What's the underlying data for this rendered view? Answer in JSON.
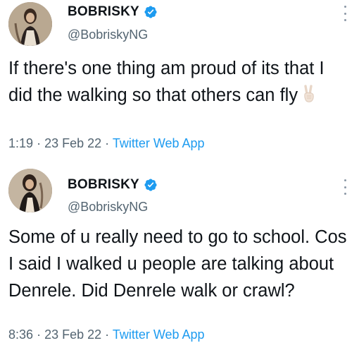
{
  "tweets": [
    {
      "author_name": "BOBRISKY",
      "handle": "@BobriskyNG",
      "text": "If there's one thing am proud of its that I did the walking so that others can fly",
      "emoji": "victory-hand",
      "time": "1:19",
      "date": "23 Feb 22",
      "source": "Twitter Web App",
      "separator": "·"
    },
    {
      "author_name": "BOBRISKY",
      "handle": "@BobriskyNG",
      "text": "Some of u really need to go to school. Cos I said I walked u people are talking about Denrele. Did Denrele walk or crawl?",
      "time": "8:36",
      "date": "23 Feb 22",
      "source": "Twitter Web App",
      "separator": "·"
    }
  ],
  "colors": {
    "verified_blue": "#1d9bf0",
    "link_blue": "#1d9bf0",
    "secondary_text": "#536471",
    "primary_text": "#0f1419"
  },
  "icons": {
    "verified": "verified-badge-icon",
    "more": "more-options-icon",
    "emoji": "victory-hand-emoji-icon"
  }
}
